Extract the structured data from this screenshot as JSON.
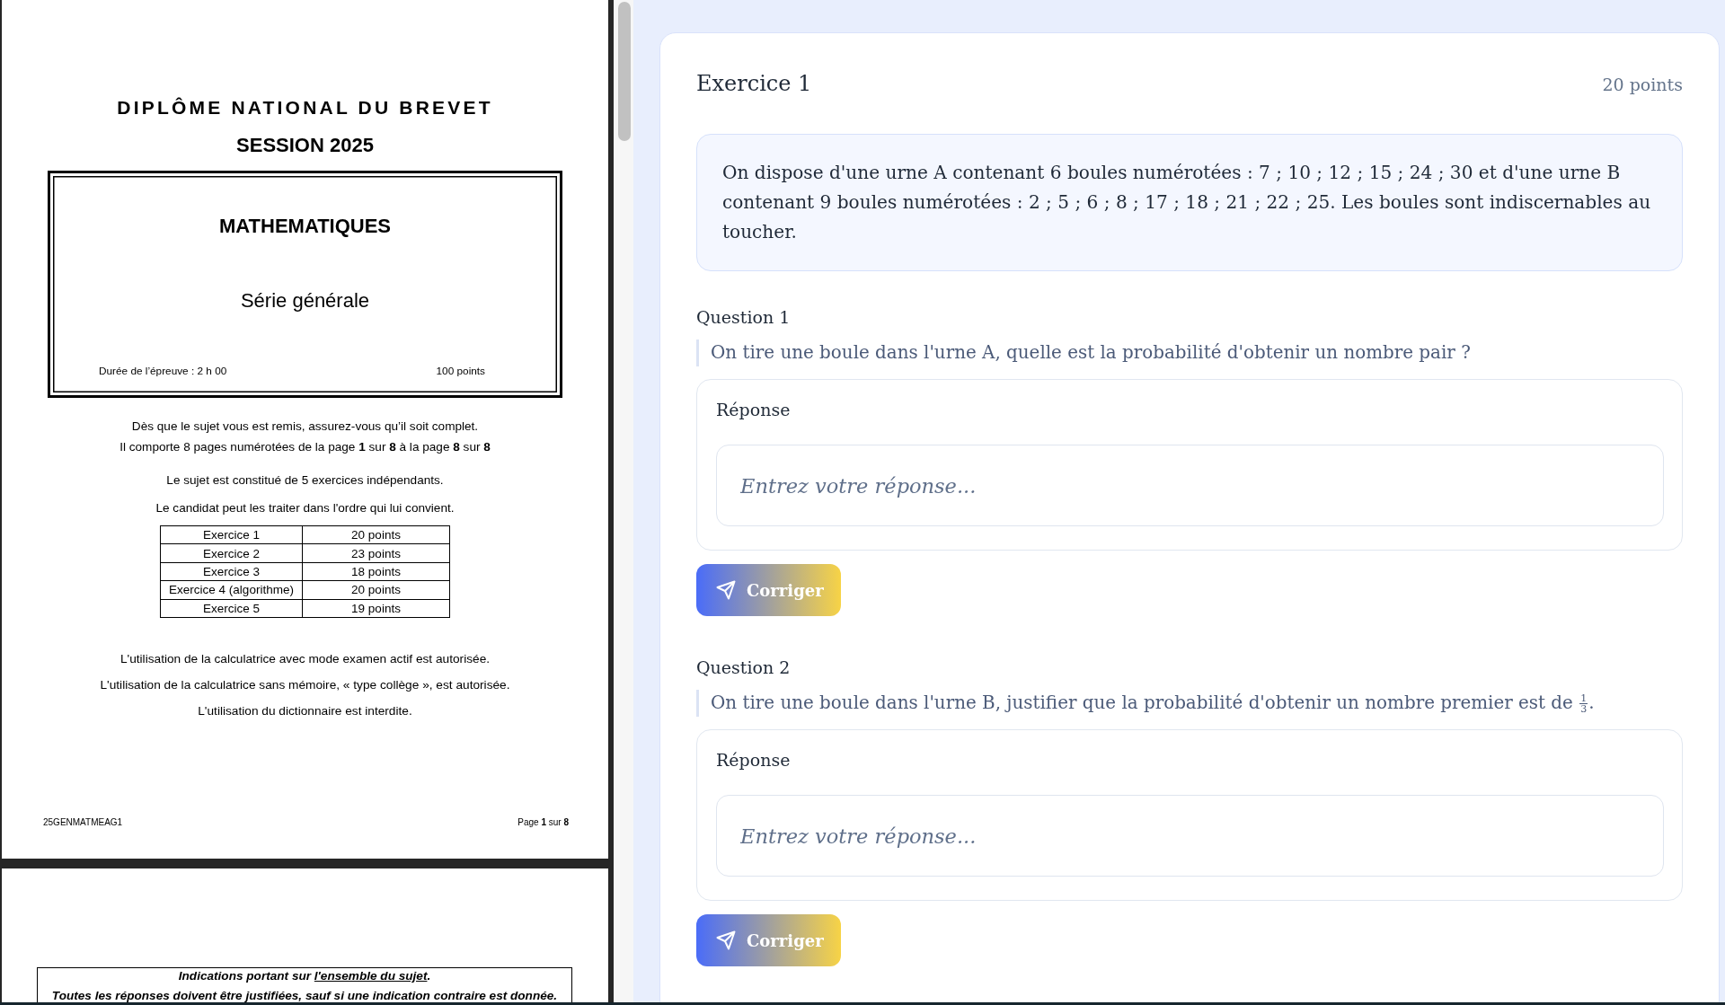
{
  "document": {
    "pages": [
      {
        "kind": "cover",
        "title": "DIPLÔME NATIONAL DU BREVET",
        "session": "SESSION 2025",
        "subject_box": {
          "subject": "MATHEMATIQUES",
          "series": "Série générale",
          "duration": "Durée de l’épreuve : 2 h 00",
          "points": "100 points"
        },
        "notes": [
          {
            "lines": [
              "Dès que le sujet vous est remis, assurez-vous qu’il soit complet.",
              "Il comporte 8 pages numérotées de la page **1** sur **8** à la page **8** sur **8**"
            ]
          },
          {
            "lines": [
              "Le sujet est constitué de 5 exercices indépendants.",
              "Le candidat peut les traiter dans l'ordre qui lui convient."
            ]
          }
        ],
        "score_table": [
          {
            "exercise": "Exercice 1",
            "points": "20 points"
          },
          {
            "exercise": "Exercice 2",
            "points": "23 points"
          },
          {
            "exercise": "Exercice 3",
            "points": "18 points"
          },
          {
            "exercise": "Exercice 4 (algorithme)",
            "points": "20 points"
          },
          {
            "exercise": "Exercice 5",
            "points": "19 points"
          }
        ],
        "rules": [
          "L'utilisation de la calculatrice avec mode examen actif est autorisée.",
          "L'utilisation de la calculatrice sans mémoire, « type collège », est autorisée.",
          "L'utilisation du dictionnaire est interdite."
        ],
        "footer": {
          "code": "25GENMATMEAG1",
          "page": "Page **1** sur **8**"
        }
      },
      {
        "kind": "notice",
        "notice": {
          "heading": "Indications portant sur",
          "underlined": "l'ensemble du sujet",
          "heading_end": ".",
          "text": "Toutes les réponses doivent être justifiées, sauf si une indication contraire est donnée."
        }
      }
    ]
  },
  "exercise": {
    "title": "Exercice 1",
    "points": "20 points",
    "statement": "On dispose d'une urne A contenant 6 boules numérotées : 7 ; 10 ; 12 ; 15 ; 24 ; 30 et d'une urne B contenant 9 boules numérotées : 2 ; 5 ; 6 ; 8 ; 17 ; 18 ; 21 ; 22 ; 25. Les boules sont indiscernables au toucher.",
    "questions": [
      {
        "label": "Question 1",
        "text": "On tire une boule dans l'urne A, quelle est la probabilité d'obtenir un nombre pair ?",
        "answer": {
          "label": "Réponse",
          "placeholder": "Entrez votre réponse..."
        },
        "submit": "Corriger"
      },
      {
        "label": "Question 2",
        "text": "On tire une boule dans l'urne B, justifier que la probabilité d'obtenir un nombre premier est de",
        "fraction": {
          "numerator": "1",
          "denominator": "3"
        },
        "text_end": ".",
        "answer": {
          "label": "Réponse",
          "placeholder": "Entrez votre réponse..."
        },
        "submit": "Corriger"
      }
    ]
  }
}
